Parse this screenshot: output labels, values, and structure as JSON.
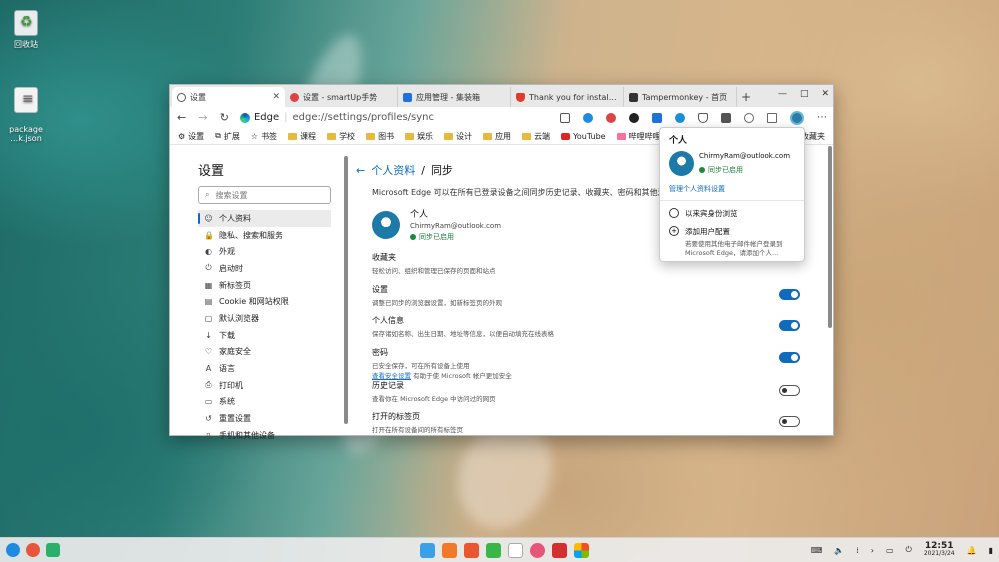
{
  "desktop": {
    "icons": [
      {
        "label": "回收站"
      },
      {
        "label": "package\n…k.json"
      }
    ]
  },
  "browser": {
    "tabs": [
      {
        "label": "设置",
        "color": "#555555"
      },
      {
        "label": "设置 - smartUp手势",
        "color": "#d44"
      },
      {
        "label": "应用管理 - 集装箱",
        "color": "#1f73d8"
      },
      {
        "label": "Thank you for installin",
        "color": "#e23b2e"
      },
      {
        "label": "Tampermonkey - 首页",
        "color": "#333333"
      }
    ],
    "window_controls": [
      "—",
      "□",
      "✕"
    ],
    "address": {
      "badge": "Edge",
      "url": "edge://settings/profiles/sync"
    },
    "bookmarks": [
      {
        "label": "设置",
        "type": "gear"
      },
      {
        "label": "扩展",
        "type": "puzzle"
      },
      {
        "label": "书签",
        "type": "star"
      },
      {
        "label": "课程",
        "type": "folder"
      },
      {
        "label": "学校",
        "type": "folder"
      },
      {
        "label": "图书",
        "type": "folder"
      },
      {
        "label": "娱乐",
        "type": "folder"
      },
      {
        "label": "设计",
        "type": "folder"
      },
      {
        "label": "应用",
        "type": "folder"
      },
      {
        "label": "云端",
        "type": "folder"
      },
      {
        "label": "YouTube",
        "type": "youtube"
      },
      {
        "label": "哔哩哔哩 (゜",
        "type": "bili"
      }
    ],
    "bookmarks_overflow": "收藏夹"
  },
  "settings": {
    "title": "设置",
    "search_placeholder": "搜索设置",
    "nav": [
      {
        "label": "个人资料",
        "icon": "☺"
      },
      {
        "label": "隐私、搜索和服务",
        "icon": "🔒"
      },
      {
        "label": "外观",
        "icon": "◐"
      },
      {
        "label": "启动时",
        "icon": "⏻"
      },
      {
        "label": "新标签页",
        "icon": "▦"
      },
      {
        "label": "Cookie 和网站权限",
        "icon": "▤"
      },
      {
        "label": "默认浏览器",
        "icon": "▢"
      },
      {
        "label": "下载",
        "icon": "↓"
      },
      {
        "label": "家庭安全",
        "icon": "♡"
      },
      {
        "label": "语言",
        "icon": "A"
      },
      {
        "label": "打印机",
        "icon": "⎙"
      },
      {
        "label": "系统",
        "icon": "▭"
      },
      {
        "label": "重置设置",
        "icon": "↺"
      },
      {
        "label": "手机和其他设备",
        "icon": "▯"
      }
    ],
    "breadcrumb": {
      "parent": "个人资料",
      "sep": "/",
      "current": "同步"
    },
    "description": "Microsoft Edge 可以在所有已登录设备之间同步历史记录、收藏夹、密码和其他浏览器数据",
    "profile": {
      "name": "个人",
      "email": "ChirmyRam@outlook.com",
      "status": "同步已启用"
    },
    "sync_items": [
      {
        "title": "收藏夹",
        "desc": "轻松访问、组织和管理已保存的页面和站点",
        "link": "",
        "link_suffix": "",
        "state": "none"
      },
      {
        "title": "设置",
        "desc": "调整已同步的浏览器设置，如新标签页的外观",
        "link": "",
        "link_suffix": "",
        "state": "on"
      },
      {
        "title": "个人信息",
        "desc": "保存诸如名称、出生日期、地址等信息，以便自动填充在线表格",
        "link": "",
        "link_suffix": "",
        "state": "on"
      },
      {
        "title": "密码",
        "desc": "已安全保存，可在所有设备上使用",
        "link": "查看安全设置",
        "link_suffix": "有助于使 Microsoft 帐户更加安全",
        "state": "on"
      },
      {
        "title": "历史记录",
        "desc": "查看你在 Microsoft Edge 中访问过的网页",
        "link": "",
        "link_suffix": "",
        "state": "off"
      },
      {
        "title": "打开的标签页",
        "desc": "打开在所有设备间的所有标签页",
        "link": "",
        "link_suffix": "",
        "state": "off"
      }
    ]
  },
  "profile_popup": {
    "title": "个人",
    "email": "ChirmyRam@outlook.com",
    "status": "同步已启用",
    "manage": "管理个人资料设置",
    "items": [
      {
        "label": "以来宾身份浏览",
        "desc": "",
        "icon": "👤"
      },
      {
        "label": "添加用户配置",
        "desc": "若要使用其他电子邮件帐户登录到 Microsoft Edge，请添加个人...",
        "icon": "+"
      }
    ]
  },
  "taskbar": {
    "clock_time": "12:51",
    "clock_date": "2021/3/24"
  }
}
